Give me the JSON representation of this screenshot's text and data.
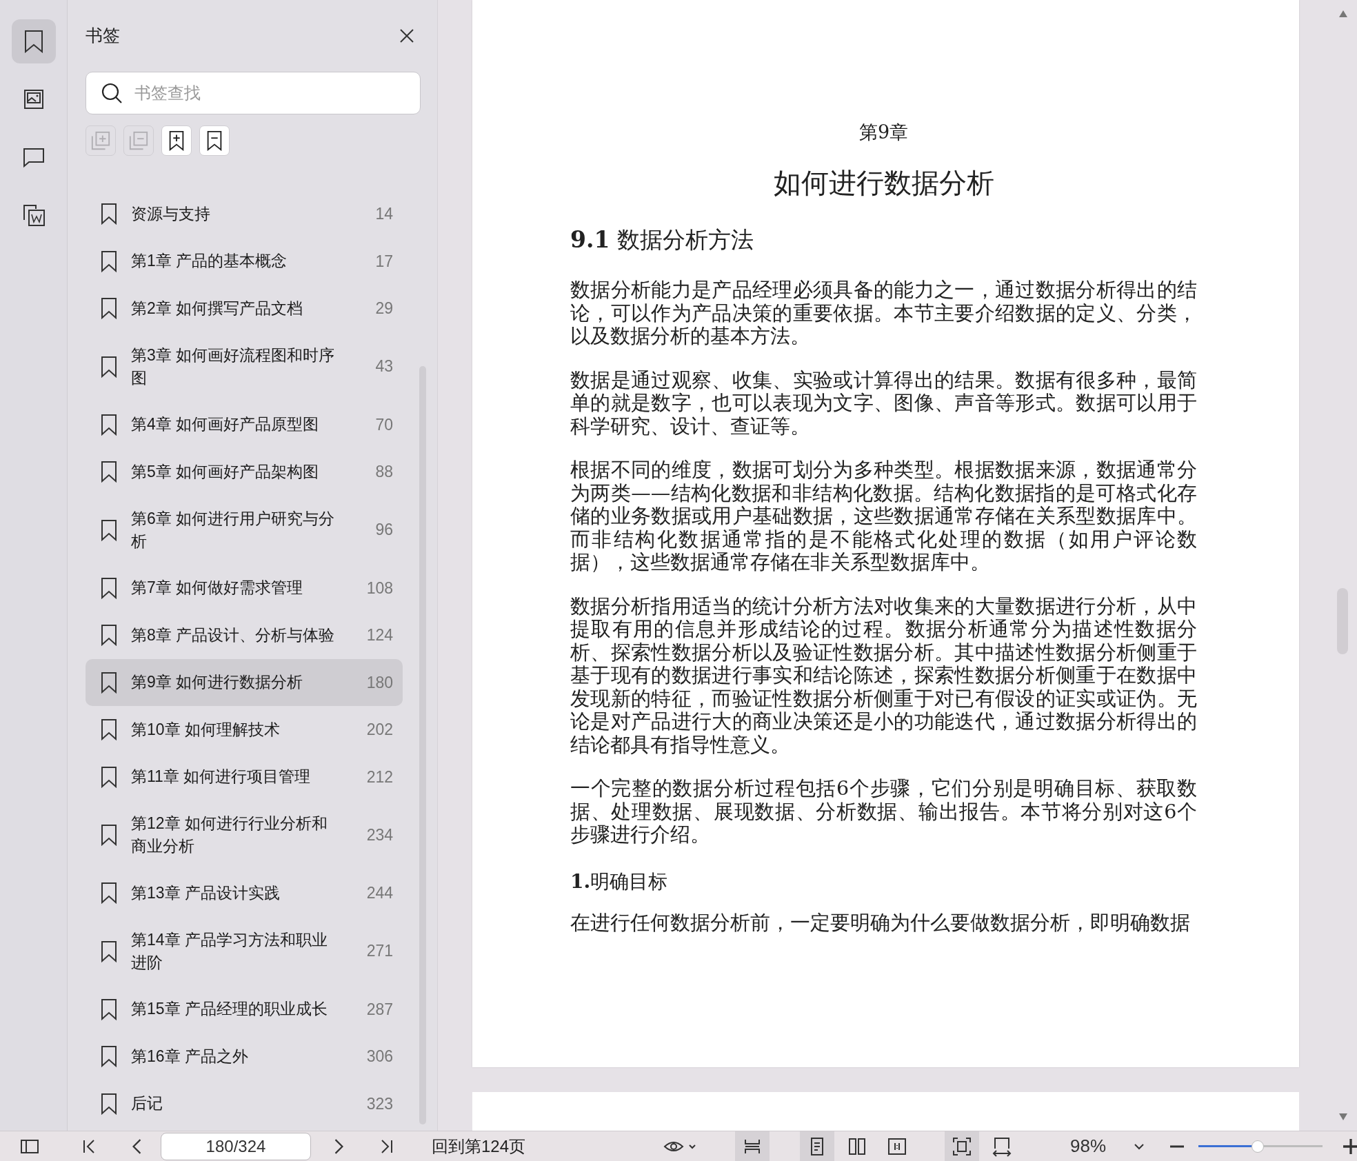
{
  "rail": [
    {
      "kind": "bookmark",
      "selected": true
    },
    {
      "kind": "image",
      "selected": false
    },
    {
      "kind": "comment",
      "selected": false
    },
    {
      "kind": "convert",
      "selected": false
    }
  ],
  "panel": {
    "title": "书签",
    "search": {
      "placeholder": "书签查找"
    },
    "tools": [
      {
        "kind": "expand",
        "disabled": true
      },
      {
        "kind": "collapse",
        "disabled": true
      },
      {
        "kind": "add",
        "disabled": false
      },
      {
        "kind": "remove",
        "disabled": false
      }
    ],
    "bookmarks": [
      {
        "label": "资源与支持",
        "page": "14",
        "selected": false
      },
      {
        "label": "第1章 产品的基本概念",
        "page": "17",
        "selected": false
      },
      {
        "label": "第2章 如何撰写产品文档",
        "page": "29",
        "selected": false
      },
      {
        "label": "第3章 如何画好流程图和时序图",
        "page": "43",
        "selected": false
      },
      {
        "label": "第4章 如何画好产品原型图",
        "page": "70",
        "selected": false
      },
      {
        "label": "第5章 如何画好产品架构图",
        "page": "88",
        "selected": false
      },
      {
        "label": "第6章 如何进行用户研究与分析",
        "page": "96",
        "selected": false
      },
      {
        "label": "第7章 如何做好需求管理",
        "page": "108",
        "selected": false
      },
      {
        "label": "第8章 产品设计、分析与体验",
        "page": "124",
        "selected": false
      },
      {
        "label": "第9章 如何进行数据分析",
        "page": "180",
        "selected": true
      },
      {
        "label": "第10章 如何理解技术",
        "page": "202",
        "selected": false
      },
      {
        "label": "第11章 如何进行项目管理",
        "page": "212",
        "selected": false
      },
      {
        "label": "第12章 如何进行行业分析和商业分析",
        "page": "234",
        "selected": false
      },
      {
        "label": "第13章 产品设计实践",
        "page": "244",
        "selected": false
      },
      {
        "label": "第14章 产品学习方法和职业进阶",
        "page": "271",
        "selected": false
      },
      {
        "label": "第15章 产品经理的职业成长",
        "page": "287",
        "selected": false
      },
      {
        "label": "第16章 产品之外",
        "page": "306",
        "selected": false
      },
      {
        "label": "后记",
        "page": "323",
        "selected": false
      }
    ]
  },
  "document": {
    "chapter_label": "第9章",
    "chapter_title": "如何进行数据分析",
    "blocks": [
      {
        "kind": "heading",
        "text": "**9.1** 数据分析方法"
      },
      {
        "kind": "paragraph",
        "text": "数据分析能力是产品经理必须具备的能力之一，通过数据分析得出的结论，可以作为产品决策的重要依据。本节主要介绍数据的定义、分类，以及数据分析的基本方法。"
      },
      {
        "kind": "paragraph",
        "text": "数据是通过观察、收集、实验或计算得出的结果。数据有很多种，最简单的就是数字，也可以表现为文字、图像、声音等形式。数据可以用于科学研究、设计、查证等。"
      },
      {
        "kind": "paragraph",
        "text": "根据不同的维度，数据可划分为多种类型。根据数据来源，数据通常分为两类——结构化数据和非结构化数据。结构化数据指的是可格式化存储的业务数据或用户基础数据，这些数据通常存储在关系型数据库中。而非结构化数据通常指的是不能格式化处理的数据（如用户评论数据），这些数据通常存储在非关系型数据库中。"
      },
      {
        "kind": "paragraph",
        "text": "数据分析指用适当的统计分析方法对收集来的大量数据进行分析，从中提取有用的信息并形成结论的过程。数据分析通常分为描述性数据分析、探索性数据分析以及验证性数据分析。其中描述性数据分析侧重于基于现有的数据进行事实和结论陈述，探索性数据分析侧重于在数据中发现新的特征，而验证性数据分析侧重于对已有假设的证实或证伪。无论是对产品进行大的商业决策还是小的功能迭代，通过数据分析得出的结论都具有指导性意义。"
      },
      {
        "kind": "paragraph",
        "text": "一个完整的数据分析过程包括6个步骤，它们分别是明确目标、获取数据、处理数据、展现数据、分析数据、输出报告。本节将分别对这6个步骤进行介绍。"
      },
      {
        "kind": "subheading",
        "text": "**1.**明确目标"
      },
      {
        "kind": "paragraph",
        "text": "在进行任何数据分析前，一定要明确为什么要做数据分析，即明确数据"
      }
    ]
  },
  "toolbar": {
    "page_field": "180/324",
    "back_link": "回到第124页",
    "zoom": "98%",
    "zoom_slider": {
      "level": 0.48
    },
    "view_buttons": [
      {
        "kind": "continuous",
        "on": true
      },
      {
        "kind": "single",
        "on": true
      },
      {
        "kind": "double",
        "on": false
      },
      {
        "kind": "center",
        "on": false
      },
      {
        "kind": "fitpage",
        "on": true
      },
      {
        "kind": "fitwidth",
        "on": false
      }
    ]
  }
}
